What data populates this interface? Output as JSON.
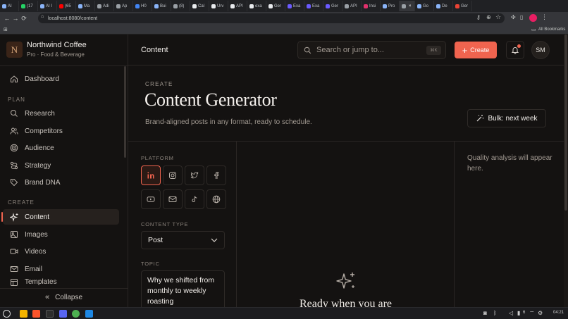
{
  "browser": {
    "tabs": [
      {
        "label": "AI",
        "color": "#8ab4f8"
      },
      {
        "label": "(17",
        "color": "#25d366"
      },
      {
        "label": "AI I",
        "color": "#8ab4f8"
      },
      {
        "label": "(65",
        "color": "#ff0000"
      },
      {
        "label": "Ma",
        "color": "#8ab4f8"
      },
      {
        "label": "Adi",
        "color": "#9aa0a6"
      },
      {
        "label": "Ap",
        "color": "#9aa0a6"
      },
      {
        "label": "H0",
        "color": "#4285f4"
      },
      {
        "label": "Bui",
        "color": "#8ab4f8"
      },
      {
        "label": "(8)",
        "color": "#9aa0a6"
      },
      {
        "label": "Cal",
        "color": "#e8eaed"
      },
      {
        "label": "Urv",
        "color": "#e8eaed"
      },
      {
        "label": "API",
        "color": "#e8eaed"
      },
      {
        "label": "exa",
        "color": "#e8eaed"
      },
      {
        "label": "Ger",
        "color": "#e8eaed"
      },
      {
        "label": "Exa",
        "color": "#6b5bff"
      },
      {
        "label": "Exa",
        "color": "#6b5bff"
      },
      {
        "label": "Ger",
        "color": "#6b5bff"
      },
      {
        "label": "API",
        "color": "#9aa0a6"
      },
      {
        "label": "Insi",
        "color": "#e1306c"
      },
      {
        "label": "Pro",
        "color": "#8ab4f8"
      },
      {
        "label": "",
        "color": "#9aa0a6",
        "active": true
      },
      {
        "label": "Go",
        "color": "#8ab4f8"
      },
      {
        "label": "De",
        "color": "#8ab4f8"
      },
      {
        "label": "Ger",
        "color": "#ea4335"
      }
    ],
    "url": "localhost:8080/content",
    "bookmarks_label": "All Bookmarks"
  },
  "sidebar": {
    "brand_initial": "N",
    "brand_name": "Northwind Coffee",
    "brand_sub": "Pro · Food & Beverage",
    "items": [
      {
        "label": "Dashboard",
        "icon": "home-icon"
      },
      {
        "label": "Research",
        "icon": "search-icon"
      },
      {
        "label": "Competitors",
        "icon": "users-icon"
      },
      {
        "label": "Audience",
        "icon": "target-icon"
      },
      {
        "label": "Strategy",
        "icon": "route-icon"
      },
      {
        "label": "Brand DNA",
        "icon": "tag-icon"
      },
      {
        "label": "Content",
        "icon": "sparkles-icon",
        "active": true
      },
      {
        "label": "Images",
        "icon": "image-icon"
      },
      {
        "label": "Videos",
        "icon": "video-icon"
      },
      {
        "label": "Email",
        "icon": "mail-icon"
      },
      {
        "label": "Templates",
        "icon": "template-icon"
      }
    ],
    "section_plan": "PLAN",
    "section_create": "CREATE",
    "collapse_label": "Collapse"
  },
  "header": {
    "title": "Content",
    "search_placeholder": "Search or jump to...",
    "search_shortcut": "⌘K",
    "create_label": "Create",
    "avatar_initials": "SM"
  },
  "hero": {
    "eyebrow": "CREATE",
    "title": "Content Generator",
    "subtitle": "Brand-aligned posts in any format, ready to schedule.",
    "bulk_label": "Bulk: next week"
  },
  "form": {
    "platform_label": "PLATFORM",
    "platforms": [
      "linkedin-icon",
      "instagram-icon",
      "twitter-icon",
      "facebook-icon",
      "youtube-icon",
      "mail-icon",
      "tiktok-icon",
      "globe-icon"
    ],
    "content_type_label": "CONTENT TYPE",
    "content_type_value": "Post",
    "topic_label": "TOPIC",
    "topic_value": "Why we shifted from monthly to weekly roasting"
  },
  "preview": {
    "ready_text": "Ready when you are"
  },
  "quality": {
    "placeholder": "Quality analysis will appear here."
  },
  "taskbar": {
    "battery": "6",
    "time": "04:21"
  },
  "colors": {
    "accent": "#f0644f",
    "bg": "#141211",
    "border": "#2a2624"
  }
}
